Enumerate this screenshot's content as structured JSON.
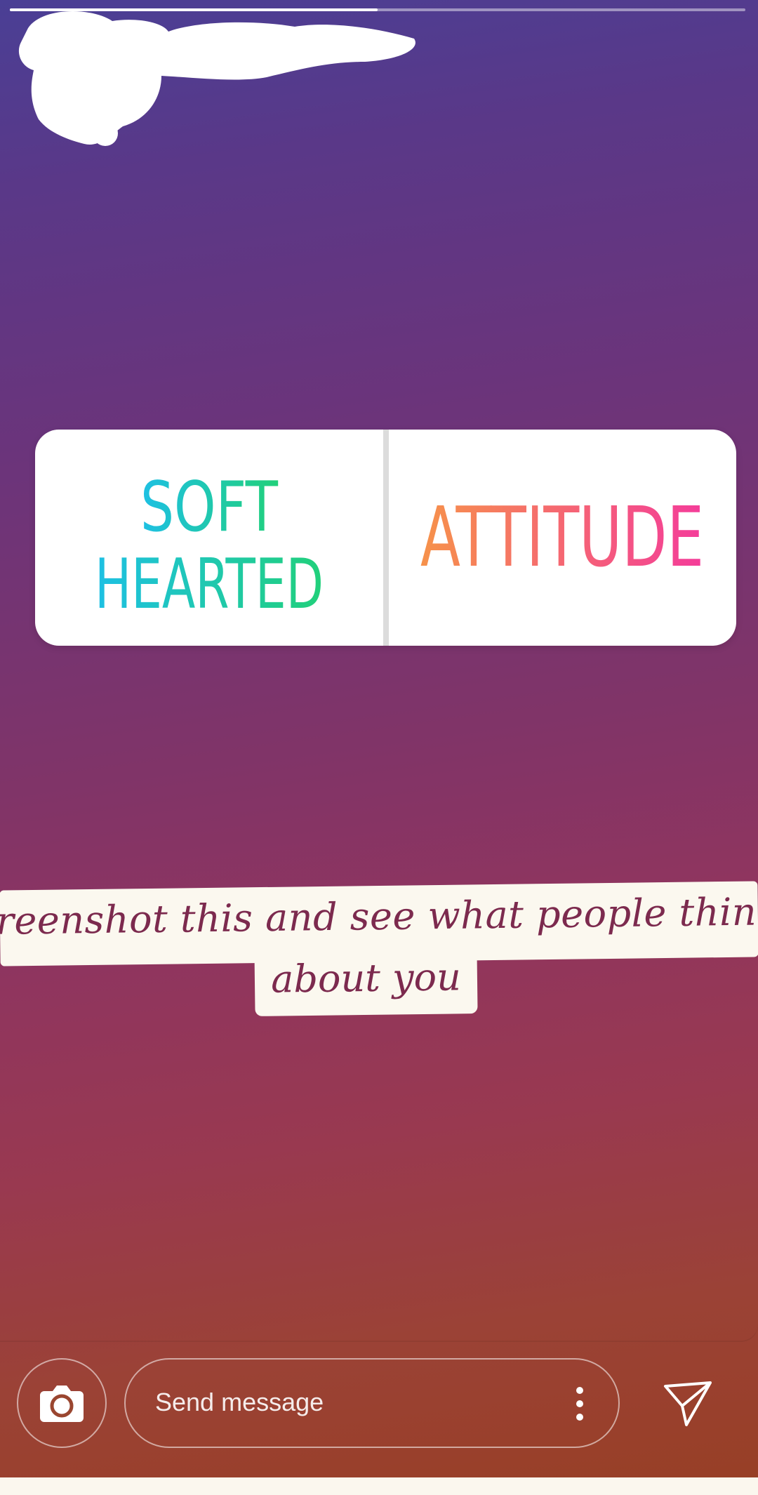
{
  "story": {
    "progress": 0.5
  },
  "poll": {
    "option_left_line1": "SOFT",
    "option_left_line2": "HEARTED",
    "option_right": "ATTITUDE"
  },
  "caption": {
    "line1": "reenshot this and see what people think",
    "line2": "about you"
  },
  "bottom_bar": {
    "camera_icon": "camera-icon",
    "message_placeholder": "Send message",
    "more_icon": "more-vertical-icon",
    "send_icon": "paper-plane-icon"
  },
  "colors": {
    "left_gradient_start": "#1ec0e4",
    "left_gradient_end": "#21d07a",
    "right_gradient_start": "#f6924a",
    "right_gradient_end": "#f43c9a",
    "caption_text": "#7c2a4e"
  }
}
